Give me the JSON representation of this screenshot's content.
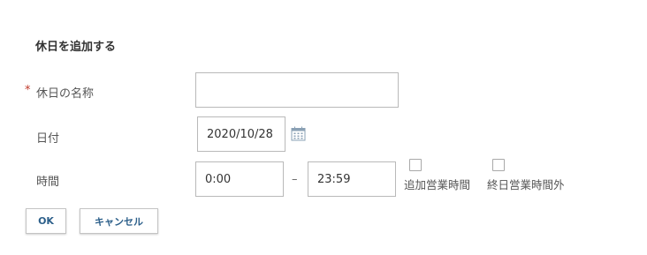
{
  "dialog": {
    "title": "休日を追加する",
    "required_mark": "*"
  },
  "fields": {
    "name": {
      "label": "休日の名称",
      "value": ""
    },
    "date": {
      "label": "日付",
      "value": "2020/10/28"
    },
    "time": {
      "label": "時間",
      "start": "0:00",
      "separator": "–",
      "end": "23:59"
    }
  },
  "options": {
    "additional_hours": {
      "label": "追加営業時間",
      "checked": false
    },
    "all_day_outside": {
      "label": "終日営業時間外",
      "checked": false
    }
  },
  "buttons": {
    "ok": "OK",
    "cancel": "キャンセル"
  },
  "icons": {
    "calendar": "calendar-icon"
  }
}
